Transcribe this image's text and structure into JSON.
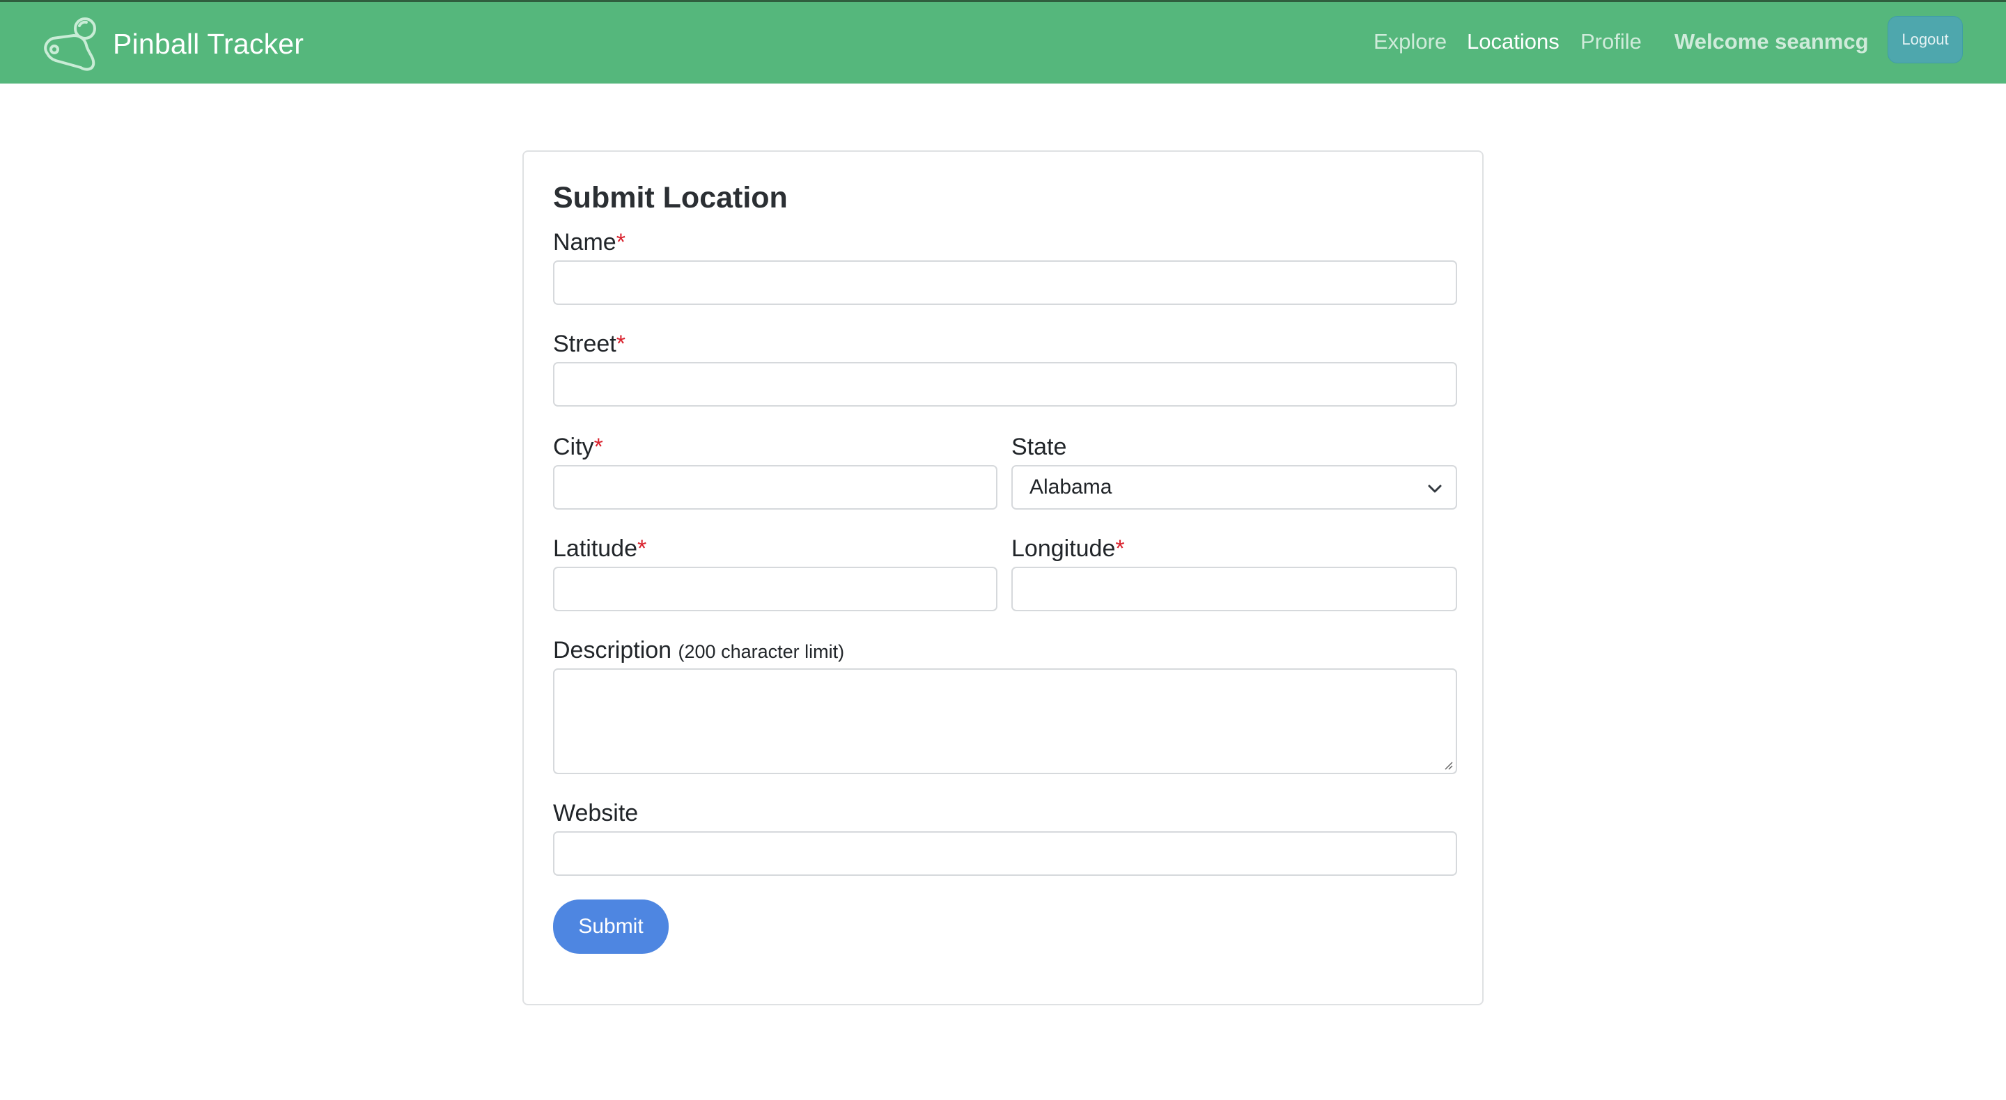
{
  "app": {
    "title": "Pinball Tracker"
  },
  "nav": {
    "links": [
      {
        "label": "Explore",
        "active": false
      },
      {
        "label": "Locations",
        "active": true
      },
      {
        "label": "Profile",
        "active": false
      }
    ],
    "welcome": "Welcome seanmcg",
    "logout_label": "Logout"
  },
  "form": {
    "title": "Submit Location",
    "fields": {
      "name": {
        "label": "Name",
        "required_mark": "*",
        "value": ""
      },
      "street": {
        "label": "Street",
        "required_mark": "*",
        "value": ""
      },
      "city": {
        "label": "City",
        "required_mark": "*",
        "value": ""
      },
      "state": {
        "label": "State",
        "selected": "Alabama"
      },
      "latitude": {
        "label": "Latitude",
        "required_mark": "*",
        "value": ""
      },
      "longitude": {
        "label": "Longitude",
        "required_mark": "*",
        "value": ""
      },
      "description": {
        "label": "Description",
        "hint": "(200 character limit)",
        "value": ""
      },
      "website": {
        "label": "Website",
        "value": ""
      }
    },
    "submit_label": "Submit"
  },
  "colors": {
    "navbar": "#55b77c",
    "logout": "#4ea7ad",
    "submit": "#4e86e1",
    "required": "#d9232e"
  }
}
